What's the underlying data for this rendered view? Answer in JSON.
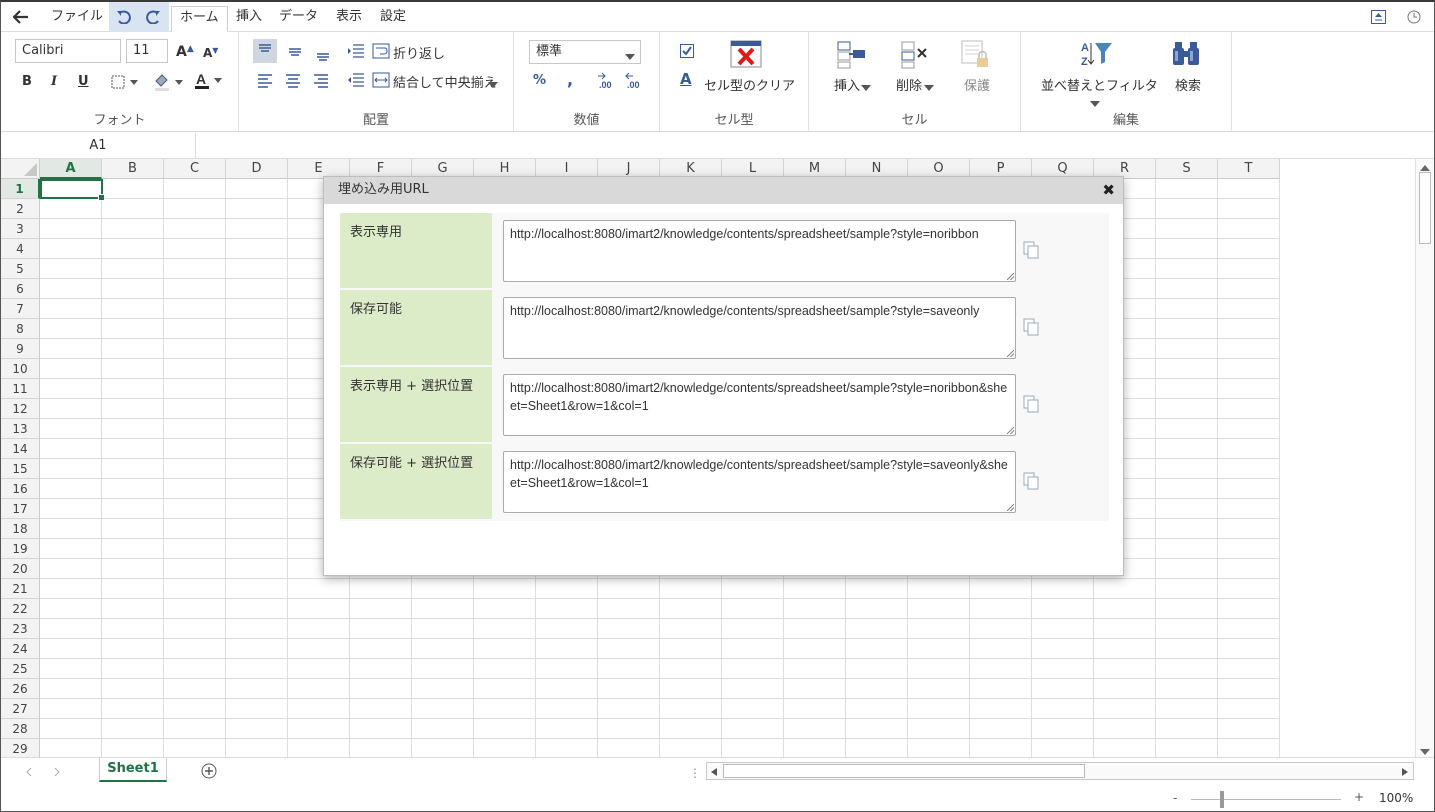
{
  "menubar": {
    "tabs": [
      "ファイル",
      "ホーム",
      "挿入",
      "データ",
      "表示",
      "設定"
    ]
  },
  "ribbon": {
    "font": {
      "name": "Calibri",
      "size": "11",
      "group_label": "フォント",
      "bold": "B",
      "italic": "I",
      "underline": "U",
      "font_color_letter": "A"
    },
    "alignment": {
      "wrap_text": "折り返し",
      "merge_center": "結合して中央揃え",
      "group_label": "配置"
    },
    "number": {
      "format": "標準",
      "percent": "%",
      "comma": ",",
      "inc_decimal": ".00",
      "dec_decimal": ".00",
      "group_label": "数値"
    },
    "cellstyle": {
      "clear_label": "セル型のクリア",
      "group_label": "セル型",
      "letter": "A"
    },
    "cells": {
      "insert": "挿入",
      "delete": "削除",
      "protect": "保護",
      "group_label": "セル"
    },
    "editing": {
      "sort_filter": "並べ替えとフィルタ",
      "find": "検索",
      "group_label": "編集"
    }
  },
  "formula_bar": {
    "cell_ref": "A1"
  },
  "grid": {
    "columns": [
      "A",
      "B",
      "C",
      "D",
      "E",
      "F",
      "G",
      "H",
      "I",
      "J",
      "K",
      "L",
      "M",
      "N",
      "O",
      "P",
      "Q",
      "R",
      "S",
      "T"
    ],
    "rows": [
      "1",
      "2",
      "3",
      "4",
      "5",
      "6",
      "7",
      "8",
      "9",
      "10",
      "11",
      "12",
      "13",
      "14",
      "15",
      "16",
      "17",
      "18",
      "19",
      "20",
      "21",
      "22",
      "23",
      "24",
      "25",
      "26",
      "27",
      "28",
      "29"
    ],
    "selected_column": "A",
    "selected_row": "1"
  },
  "dialog": {
    "title": "埋め込み用URL",
    "close_glyph": "✖",
    "rows": [
      {
        "label": "表示専用",
        "url": "http://localhost:8080/imart2/knowledge/contents/spreadsheet/sample?style=noribbon"
      },
      {
        "label": "保存可能",
        "url": "http://localhost:8080/imart2/knowledge/contents/spreadsheet/sample?style=saveonly"
      },
      {
        "label": "表示専用 + 選択位置",
        "url": "http://localhost:8080/imart2/knowledge/contents/spreadsheet/sample?style=noribbon&sheet=Sheet1&row=1&col=1"
      },
      {
        "label": "保存可能 + 選択位置",
        "url": "http://localhost:8080/imart2/knowledge/contents/spreadsheet/sample?style=saveonly&sheet=Sheet1&row=1&col=1"
      }
    ]
  },
  "sheets": {
    "active": "Sheet1"
  },
  "status": {
    "zoom": "100%",
    "zoom_out": "-",
    "zoom_in": "+"
  },
  "colors": {
    "accent": "#217346",
    "label_bg": "#dcebc8",
    "ribbon_text": "#333333"
  }
}
